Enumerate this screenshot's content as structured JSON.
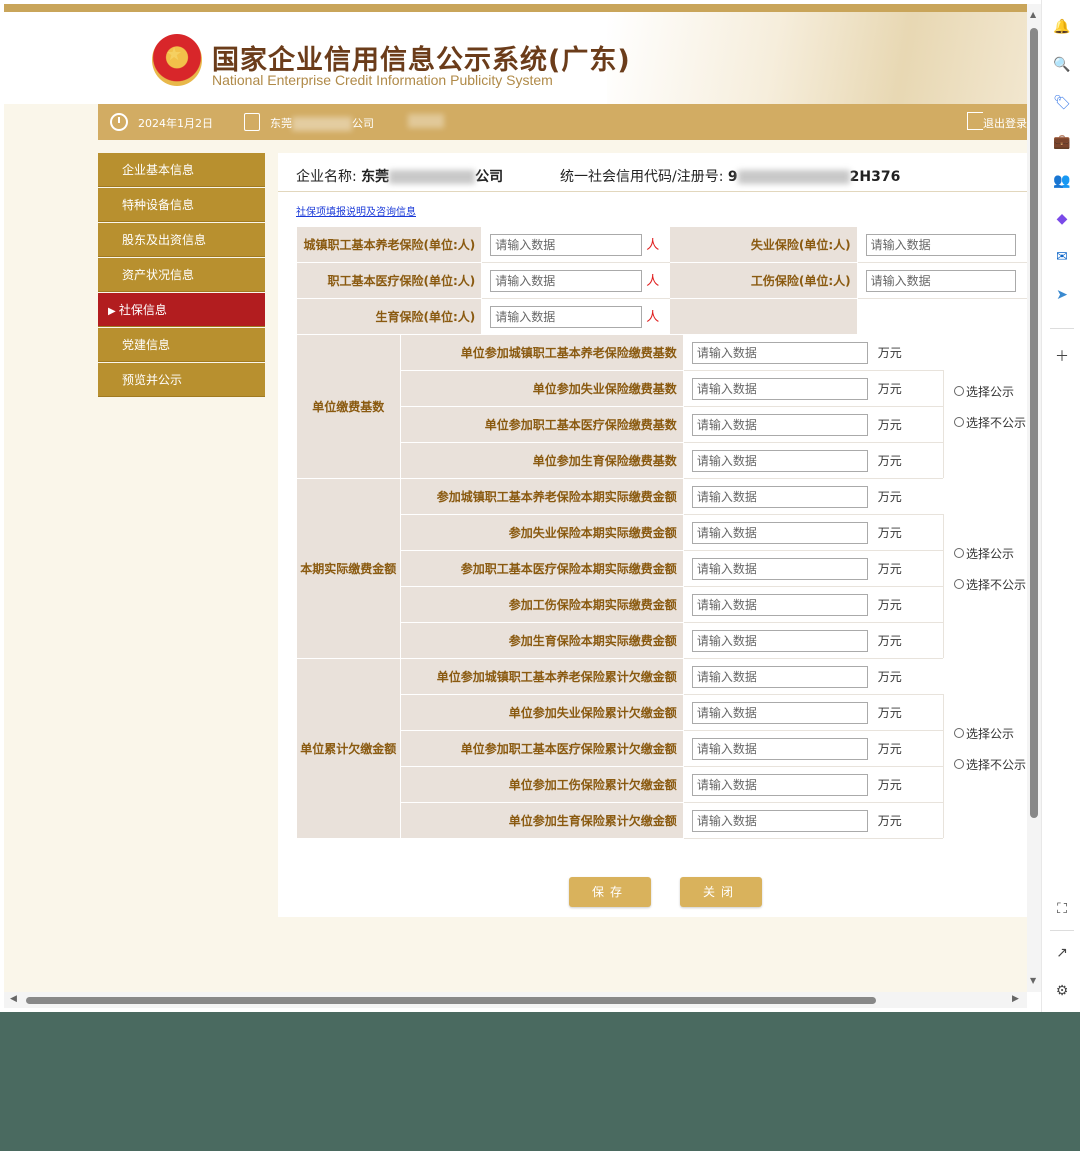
{
  "header": {
    "title": "国家企业信用信息公示系统(广东)",
    "subtitle": "National Enterprise Credit Information Publicity System"
  },
  "userbar": {
    "date": "2024年1月2日",
    "company_prefix": "东莞",
    "company_suffix": "公司",
    "logout": "退出登录"
  },
  "sidebar": {
    "items": [
      {
        "label": "企业基本信息"
      },
      {
        "label": "特种设备信息"
      },
      {
        "label": "股东及出资信息"
      },
      {
        "label": "资产状况信息"
      },
      {
        "label": "社保信息",
        "active": true
      },
      {
        "label": "党建信息"
      },
      {
        "label": "预览并公示"
      }
    ]
  },
  "main": {
    "company_label": "企业名称:",
    "company_prefix": "东莞",
    "company_suffix": "公司",
    "credit_label": "统一社会信用代码/注册号:",
    "credit_prefix": "9",
    "credit_suffix": "2H376",
    "help_link": "社保项填报说明及咨询信息",
    "placeholder": "请输入数据",
    "person_unit": "人",
    "money_unit": "万元",
    "insured_rows": [
      {
        "left_label": "城镇职工基本养老保险(单位:人)",
        "right_label": "失业保险(单位:人)"
      },
      {
        "left_label": "职工基本医疗保险(单位:人)",
        "right_label": "工伤保险(单位:人)"
      },
      {
        "left_label": "生育保险(单位:人)",
        "right_label": ""
      }
    ],
    "groups": [
      {
        "title": "单位缴费基数",
        "rows": [
          "单位参加城镇职工基本养老保险缴费基数",
          "单位参加失业保险缴费基数",
          "单位参加职工基本医疗保险缴费基数",
          "单位参加生育保险缴费基数"
        ],
        "radio1": "选择公示",
        "radio2": "选择不公示"
      },
      {
        "title": "本期实际缴费金额",
        "rows": [
          "参加城镇职工基本养老保险本期实际缴费金额",
          "参加失业保险本期实际缴费金额",
          "参加职工基本医疗保险本期实际缴费金额",
          "参加工伤保险本期实际缴费金额",
          "参加生育保险本期实际缴费金额"
        ],
        "radio1": "选择公示",
        "radio2": "选择不公示"
      },
      {
        "title": "单位累计欠缴金额",
        "rows": [
          "单位参加城镇职工基本养老保险累计欠缴金额",
          "单位参加失业保险累计欠缴金额",
          "单位参加职工基本医疗保险累计欠缴金额",
          "单位参加工伤保险累计欠缴金额",
          "单位参加生育保险累计欠缴金额"
        ],
        "radio1": "选择公示",
        "radio2": "选择不公示"
      }
    ],
    "save_label": "保存",
    "close_label": "关闭"
  },
  "colors": {
    "gold": "#d2ac63",
    "nav": "#b8902f",
    "nav_active": "#b21d1f",
    "label_bg": "#e9e1da",
    "label_text": "#8a5a10"
  },
  "edge_icons": [
    "bell-icon",
    "search-icon",
    "tag-icon",
    "briefcase-icon",
    "people-icon",
    "copilot-icon",
    "outlook-icon",
    "send-icon",
    "add-icon",
    "screenshot-icon",
    "open-external-icon",
    "settings-icon"
  ]
}
